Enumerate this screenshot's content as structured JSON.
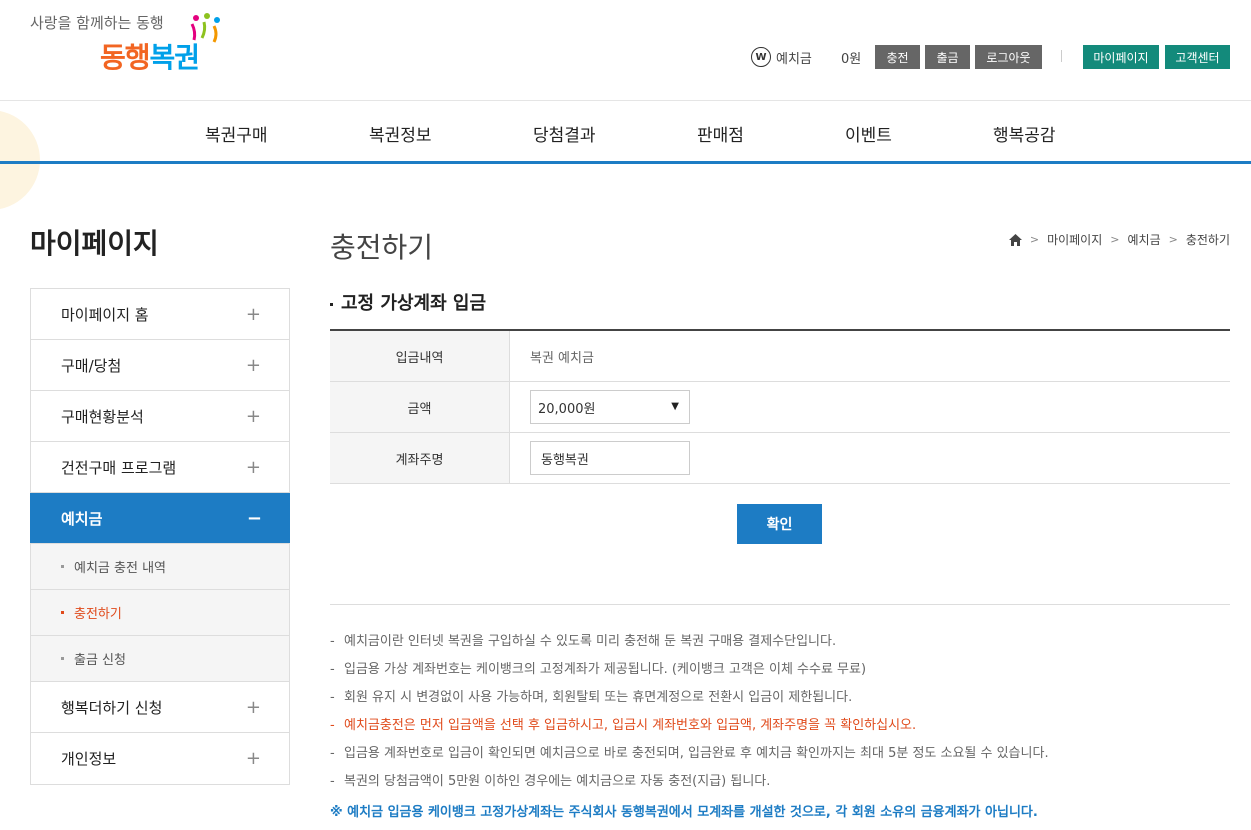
{
  "header": {
    "slogan": "사랑을 함께하는 동행",
    "brand_part1": "동행",
    "brand_part2": "복권",
    "wallet_icon_letter": "W",
    "deposit_label": "예치금",
    "deposit_amount": "0원",
    "btn_charge": "충전",
    "btn_withdraw": "출금",
    "btn_logout": "로그아웃",
    "btn_mypage": "마이페이지",
    "btn_support": "고객센터"
  },
  "gnb": [
    "복권구매",
    "복권정보",
    "당첨결과",
    "판매점",
    "이벤트",
    "행복공감"
  ],
  "sidebar": {
    "title": "마이페이지",
    "items": [
      {
        "label": "마이페이지 홈",
        "icon": "+"
      },
      {
        "label": "구매/당첨",
        "icon": "+"
      },
      {
        "label": "구매현황분석",
        "icon": "+"
      },
      {
        "label": "건전구매 프로그램",
        "icon": "+"
      },
      {
        "label": "예치금",
        "icon": "−"
      },
      {
        "label": "행복더하기 신청",
        "icon": "+"
      },
      {
        "label": "개인정보",
        "icon": "+"
      }
    ],
    "subitems": [
      "예치금 충전 내역",
      "충전하기",
      "출금 신청"
    ]
  },
  "page": {
    "title": "충전하기",
    "breadcrumb": [
      "마이페이지",
      "예치금",
      "충전하기"
    ]
  },
  "form": {
    "section_title": "고정 가상계좌 입금",
    "rows": [
      {
        "label": "입금내역",
        "value": "복권 예치금"
      },
      {
        "label": "금액",
        "value": "20,000원"
      },
      {
        "label": "계좌주명",
        "value": "동행복권"
      }
    ],
    "confirm_label": "확인"
  },
  "notes": [
    "예치금이란 인터넷 복권을 구입하실 수 있도록 미리 충전해 둔 복권 구매용 결제수단입니다.",
    "입금용 가상 계좌번호는 케이뱅크의 고정계좌가 제공됩니다. (케이뱅크 고객은 이체 수수료 무료)",
    "회원 유지 시 변경없이 사용 가능하며, 회원탈퇴 또는 휴면계정으로 전환시 입금이 제한됩니다.",
    "예치금충전은 먼저 입금액을 선택 후 입금하시고, 입금시 계좌번호와 입금액, 계좌주명을 꼭 확인하십시오.",
    "입금용 계좌번호로 입금이 확인되면 예치금으로 바로 충전되며, 입금완료 후 예치금 확인까지는 최대 5분 정도 소요될 수 있습니다.",
    "복권의 당첨금액이 5만원 이하인 경우에는 예치금으로 자동 충전(지급) 됩니다."
  ],
  "note_dash": "-",
  "note_footer": "※ 예치금 입금용 케이뱅크 고정가상계좌는 주식회사 동행복권에서 모계좌를 개설한 것으로, 각 회원 소유의 금융계좌가 아닙니다.",
  "colors": {
    "primary": "#1d7cc4",
    "accent_red": "#e04a1b",
    "green": "#138a7b",
    "gray_btn": "#666666"
  }
}
